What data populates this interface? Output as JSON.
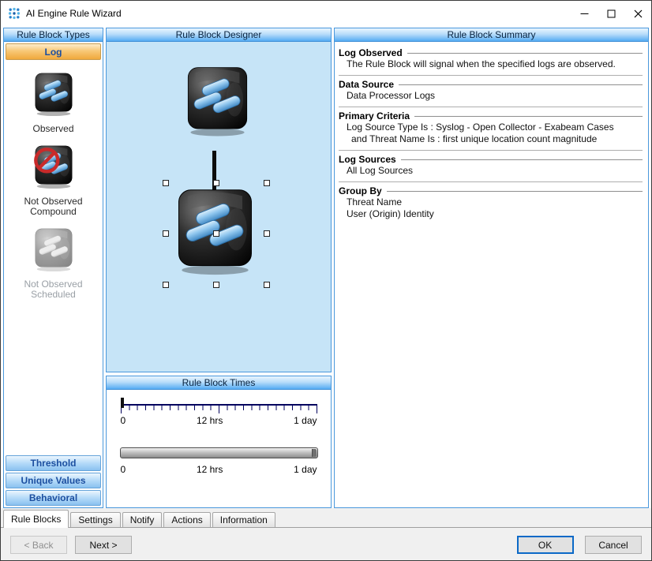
{
  "window": {
    "title": "AI Engine Rule Wizard"
  },
  "left_panel": {
    "header": "Rule Block Types",
    "log_tab": "Log",
    "items": [
      {
        "label": "Observed"
      },
      {
        "label": "Not Observed Compound"
      },
      {
        "label": "Not Observed Scheduled"
      }
    ],
    "bottom_tabs": [
      {
        "label": "Threshold"
      },
      {
        "label": "Unique Values"
      },
      {
        "label": "Behavioral"
      }
    ]
  },
  "designer": {
    "header": "Rule Block Designer"
  },
  "times": {
    "header": "Rule Block Times",
    "ruler_labels": [
      "0",
      "12 hrs",
      "1 day"
    ],
    "slider_labels": [
      "0",
      "12 hrs",
      "1 day"
    ]
  },
  "summary": {
    "header": "Rule Block Summary",
    "sections": [
      {
        "title": "Log Observed",
        "lines": [
          "The Rule Block will signal when the specified logs are observed."
        ]
      },
      {
        "title": "Data Source",
        "lines": [
          "Data Processor Logs"
        ]
      },
      {
        "title": "Primary Criteria",
        "lines": [
          "Log Source Type Is : Syslog - Open Collector - Exabeam Cases",
          "and Threat Name Is : first unique location count magnitude"
        ]
      },
      {
        "title": "Log Sources",
        "lines": [
          "All Log Sources"
        ]
      },
      {
        "title": "Group By",
        "lines": [
          "Threat Name",
          "User (Origin) Identity"
        ]
      }
    ]
  },
  "footer_tabs": [
    {
      "label": "Rule Blocks"
    },
    {
      "label": "Settings"
    },
    {
      "label": "Notify"
    },
    {
      "label": "Actions"
    },
    {
      "label": "Information"
    }
  ],
  "footer": {
    "back": "< Back",
    "next": "Next >",
    "ok": "OK",
    "cancel": "Cancel"
  },
  "colors": {
    "accent_blue": "#55acf3",
    "selected_tab_orange": "#f0a83c",
    "canvas_blue": "#c6e4f7",
    "ruler_navy": "#00005e"
  }
}
